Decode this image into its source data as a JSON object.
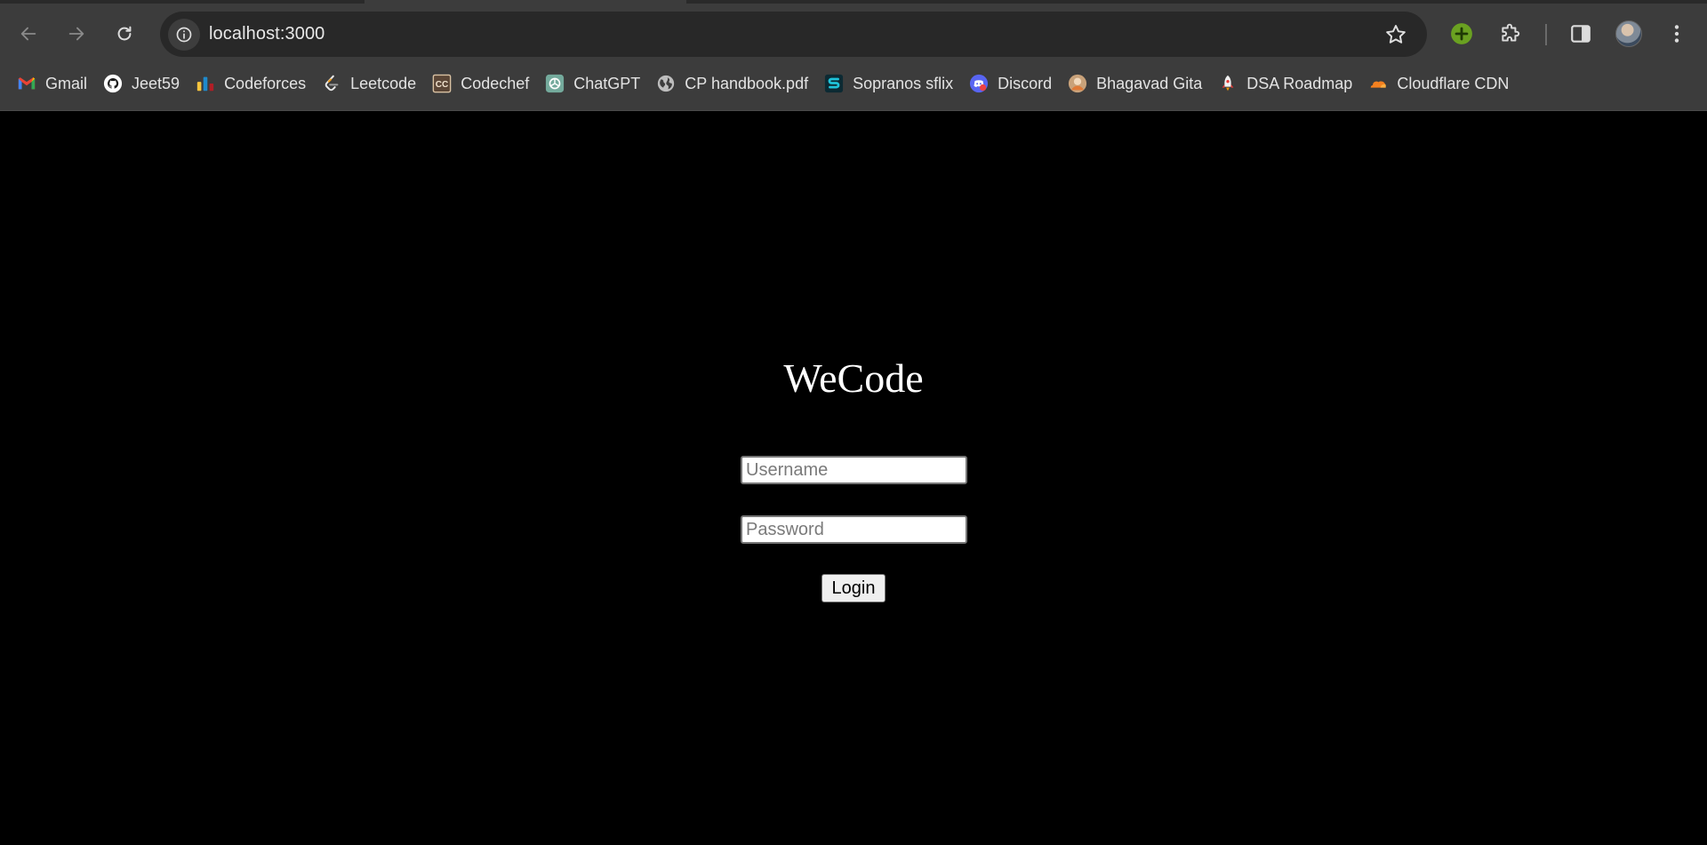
{
  "browser": {
    "address_bar": {
      "url": "localhost:3000"
    },
    "bookmarks": [
      {
        "label": "Gmail",
        "icon": "gmail-icon"
      },
      {
        "label": "Jeet59",
        "icon": "github-icon"
      },
      {
        "label": "Codeforces",
        "icon": "codeforces-icon"
      },
      {
        "label": "Leetcode",
        "icon": "leetcode-icon"
      },
      {
        "label": "Codechef",
        "icon": "codechef-icon"
      },
      {
        "label": "ChatGPT",
        "icon": "chatgpt-icon"
      },
      {
        "label": "CP handbook.pdf",
        "icon": "globe-icon"
      },
      {
        "label": "Sopranos sflix",
        "icon": "sflix-icon"
      },
      {
        "label": "Discord",
        "icon": "discord-icon"
      },
      {
        "label": "Bhagavad Gita",
        "icon": "bhagavad-gita-icon"
      },
      {
        "label": "DSA Roadmap",
        "icon": "rocket-icon"
      },
      {
        "label": "Cloudflare CDN",
        "icon": "cloudflare-icon"
      }
    ],
    "colors": {
      "chrome": "#3c3c3c",
      "omnibox": "#282828",
      "page_background": "#000000"
    }
  },
  "login": {
    "title": "WeCode",
    "username_placeholder": "Username",
    "password_placeholder": "Password",
    "submit_label": "Login"
  }
}
